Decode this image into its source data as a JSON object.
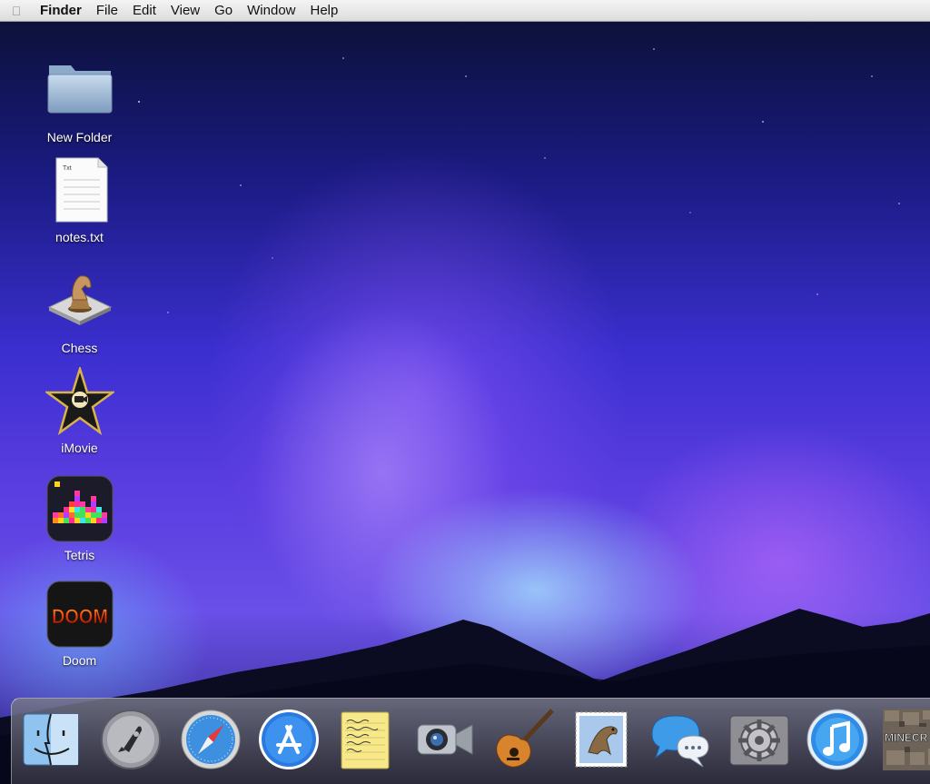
{
  "menubar": {
    "app_name": "Finder",
    "items": [
      "File",
      "Edit",
      "View",
      "Go",
      "Window",
      "Help"
    ]
  },
  "desktop_icons": [
    {
      "label": "New Folder",
      "icon": "folder-icon"
    },
    {
      "label": "notes.txt",
      "icon": "text-file-icon",
      "badge": "Txt"
    },
    {
      "label": "Chess",
      "icon": "chess-icon"
    },
    {
      "label": "iMovie",
      "icon": "imovie-icon"
    },
    {
      "label": "Tetris",
      "icon": "tetris-icon"
    },
    {
      "label": "Doom",
      "icon": "doom-icon",
      "logo_text": "DOOM"
    }
  ],
  "dock": {
    "items": [
      {
        "icon": "finder-icon"
      },
      {
        "icon": "launchpad-icon"
      },
      {
        "icon": "safari-icon"
      },
      {
        "icon": "app-store-icon"
      },
      {
        "icon": "notes-icon"
      },
      {
        "icon": "facetime-icon"
      },
      {
        "icon": "garageband-icon"
      },
      {
        "icon": "mail-icon"
      },
      {
        "icon": "messages-icon"
      },
      {
        "icon": "system-preferences-icon"
      },
      {
        "icon": "itunes-icon"
      },
      {
        "icon": "minecraft-icon",
        "label": "MINECR"
      }
    ]
  },
  "colors": {
    "menubar": "#e6e6e6",
    "sky_top": "#0a1030",
    "aurora_purple": "#6a4fe8",
    "aurora_cyan": "#aaebff",
    "mountains": "#0c0c24"
  }
}
